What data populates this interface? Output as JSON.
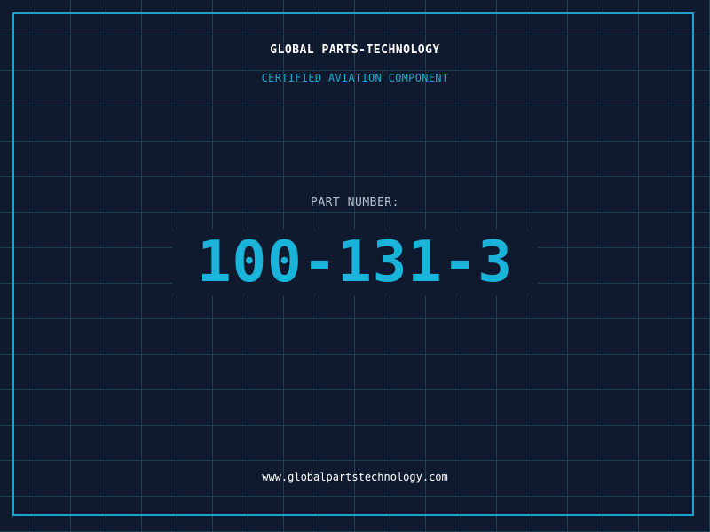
{
  "header": {
    "company": "GLOBAL PARTS-TECHNOLOGY",
    "tagline": "CERTIFIED AVIATION COMPONENT"
  },
  "part": {
    "label": "PART NUMBER:",
    "number": "100-131-3"
  },
  "footer": {
    "url": "www.globalpartstechnology.com"
  },
  "colors": {
    "background": "#101a2e",
    "grid": "#1f3f57",
    "accent": "#1ab3d9",
    "frame": "#1aa3cc",
    "text": "#ffffff",
    "muted": "#b4c0cc"
  }
}
